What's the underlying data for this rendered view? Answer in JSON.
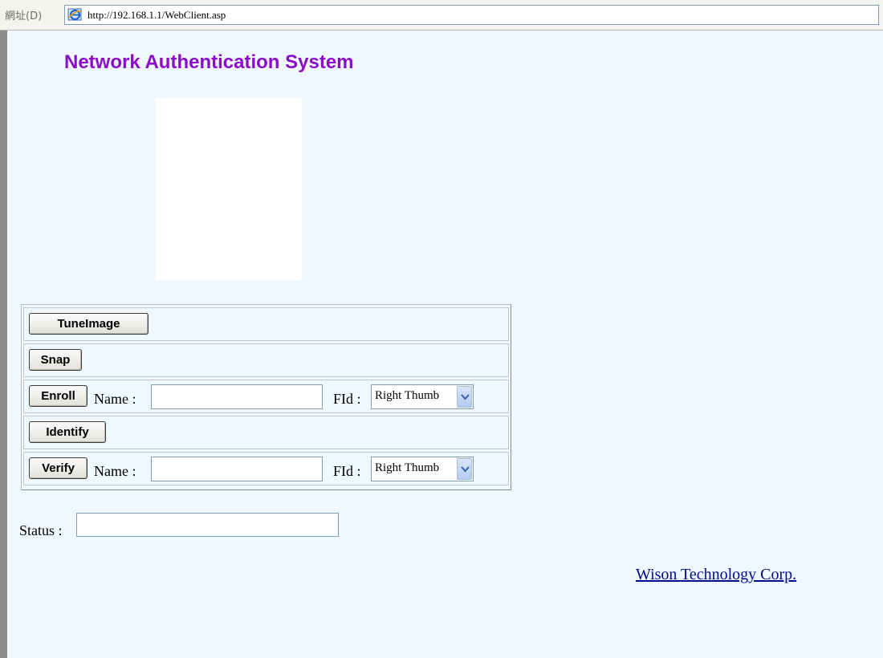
{
  "browser": {
    "address_label": "網址(D)",
    "url": "http://192.168.1.1/WebClient.asp"
  },
  "page": {
    "title": "Network Authentication System",
    "controls": {
      "tune_image_label": "TuneImage",
      "snap_label": "Snap",
      "enroll": {
        "button_label": "Enroll",
        "name_label": "Name :",
        "name_value": "",
        "fid_label": "FId :",
        "fid_selected": "Right Thumb"
      },
      "identify_label": "Identify",
      "verify": {
        "button_label": "Verify",
        "name_label": "Name :",
        "name_value": "",
        "fid_label": "FId :",
        "fid_selected": "Right Thumb"
      }
    },
    "status": {
      "label": "Status :",
      "value": ""
    },
    "footer_link": "Wison Technology Corp."
  },
  "colors": {
    "page_background": "#f0f8ff",
    "title": "#8b0cc8",
    "link": "#000a8a"
  },
  "icons": [
    "ie-icon",
    "chevron-down-icon"
  ]
}
